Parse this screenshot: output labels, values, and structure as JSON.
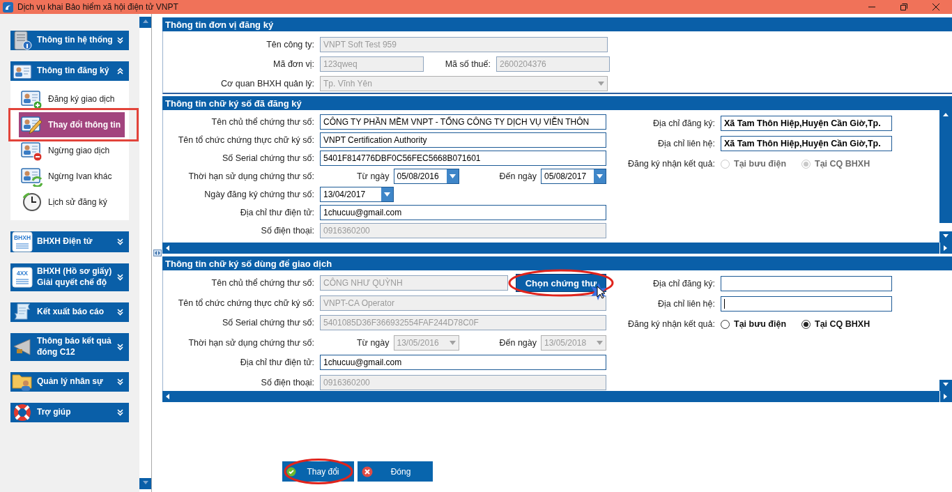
{
  "window": {
    "title": "Dịch vụ khai Bảo hiểm xã hội điện tử VNPT"
  },
  "sidebar": {
    "groups": [
      {
        "label": "Thông tin hệ thống",
        "kind": "server",
        "expanded": false
      },
      {
        "label": "Thông tin đăng ký",
        "kind": "card",
        "expanded": true,
        "items": [
          {
            "label": "Đăng ký giao dịch",
            "kind": "add",
            "selected": false,
            "highlighted": false
          },
          {
            "label": "Thay đổi thông tin",
            "kind": "edit",
            "selected": true,
            "highlighted": true
          },
          {
            "label": "Ngừng giao dịch",
            "kind": "remove",
            "selected": false,
            "highlighted": false
          },
          {
            "label": "Ngừng Ivan khác",
            "kind": "sync",
            "selected": false,
            "highlighted": false
          },
          {
            "label": "Lịch sử đăng ký",
            "kind": "history",
            "selected": false,
            "highlighted": false
          }
        ]
      },
      {
        "label": "BHXH Điện tử",
        "kind": "document",
        "badge": "BHXH",
        "expanded": false
      },
      {
        "label": "BHXH (Hồ sơ giấy)\nGiải quyết chế độ",
        "kind": "document",
        "badge": "4XX",
        "expanded": false
      },
      {
        "label": "Kết xuất báo cáo",
        "kind": "scroll",
        "expanded": false
      },
      {
        "label": "Thông báo kết quả\nđóng C12",
        "kind": "megaphone",
        "expanded": false
      },
      {
        "label": "Quản lý nhân sự",
        "kind": "folder",
        "expanded": false
      },
      {
        "label": "Trợ giúp",
        "kind": "lifebuoy",
        "expanded": false
      }
    ]
  },
  "unit": {
    "title": "Thông tin đơn vị đăng ký",
    "company": {
      "label": "Tên công ty:",
      "value": "VNPT Soft Test 959",
      "disabled": true
    },
    "unit_code": {
      "label": "Mã đơn vị:",
      "value": "123qweq",
      "disabled": true
    },
    "tax_code": {
      "label": "Mã số thuế:",
      "value": "2600204376",
      "disabled": true
    },
    "agency": {
      "label": "Cơ quan BHXH quản lý:",
      "value": "Tp. Vĩnh Yên",
      "disabled": true
    }
  },
  "registered": {
    "title": "Thông tin chữ ký số đã đăng ký",
    "holder": {
      "label": "Tên chủ thể chứng thư số:",
      "value": "CÔNG TY PHẦN MỀM VNPT - TỔNG CÔNG TY DỊCH VỤ VIỄN THÔN",
      "disabled": false
    },
    "issuer": {
      "label": "Tên tổ chức chứng thực chữ ký số:",
      "value": "VNPT Certification Authority",
      "disabled": false
    },
    "serial": {
      "label": "Số Serial chứng thư số:",
      "value": "5401F814776DBF0C56FEC5668B071601",
      "disabled": false
    },
    "validity": {
      "label": "Thời hạn sử dụng chứng thư số:",
      "from_label": "Từ ngày",
      "from": "05/08/2016",
      "to_label": "Đến ngày",
      "to": "05/08/2017",
      "disabled": false
    },
    "reg_date": {
      "label": "Ngày đăng ký chứng thư số:",
      "value": "13/04/2017",
      "disabled": false
    },
    "email": {
      "label": "Địa chỉ thư điện tử:",
      "value": "1chucuu@gmail.com",
      "disabled": false
    },
    "phone": {
      "label": "Số điện thoại:",
      "value": "0916360200",
      "disabled": true
    },
    "reg_address": {
      "label": "Địa chỉ đăng ký:",
      "value": "Xã Tam Thôn Hiệp,Huyện Cần Giờ,Tp.",
      "disabled": false
    },
    "contact_address": {
      "label": "Địa chỉ liên hệ:",
      "value": "Xã Tam Thôn Hiệp,Huyện Cần Giờ,Tp.",
      "disabled": false
    },
    "receive": {
      "label": "Đăng ký nhận kết quả:",
      "disabled": true,
      "options": [
        {
          "label": "Tại bưu điện",
          "selected": false
        },
        {
          "label": "Tại CQ BHXH",
          "selected": true
        }
      ]
    }
  },
  "transaction": {
    "title": "Thông tin chữ ký số dùng để giao dịch",
    "holder": {
      "label": "Tên chủ thể chứng thư số:",
      "value": "CÔNG NHƯ QUỲNH",
      "disabled": true
    },
    "choose_button": {
      "label": "Chọn chứng thư",
      "highlighted": true
    },
    "issuer": {
      "label": "Tên tổ chức chứng thực chữ ký số:",
      "value": "VNPT-CA Operator",
      "disabled": true
    },
    "serial": {
      "label": "Số Serial chứng thư số:",
      "value": "5401085D36F366932554FAF244D78C0F",
      "disabled": true
    },
    "validity": {
      "label": "Thời hạn sử dụng chứng thư số:",
      "from_label": "Từ ngày",
      "from": "13/05/2016",
      "to_label": "Đến ngày",
      "to": "13/05/2018",
      "disabled": true
    },
    "email": {
      "label": "Địa chỉ thư điện tử:",
      "value": "1chucuu@gmail.com",
      "disabled": false
    },
    "phone": {
      "label": "Số điện thoại:",
      "value": "0916360200",
      "disabled": true
    },
    "reg_address": {
      "label": "Địa chỉ đăng ký:",
      "disabled": false,
      "focused": false
    },
    "contact_address": {
      "label": "Địa chỉ liên hệ:",
      "disabled": false,
      "focused": true
    },
    "receive": {
      "label": "Đăng ký nhận kết quả:",
      "disabled": false,
      "options": [
        {
          "label": "Tại bưu điện",
          "selected": false
        },
        {
          "label": "Tại CQ BHXH",
          "selected": true
        }
      ]
    }
  },
  "buttons": [
    {
      "label": "Thay đổi",
      "kind": "confirm",
      "highlighted": true
    },
    {
      "label": "Đóng",
      "kind": "close",
      "highlighted": false
    }
  ]
}
